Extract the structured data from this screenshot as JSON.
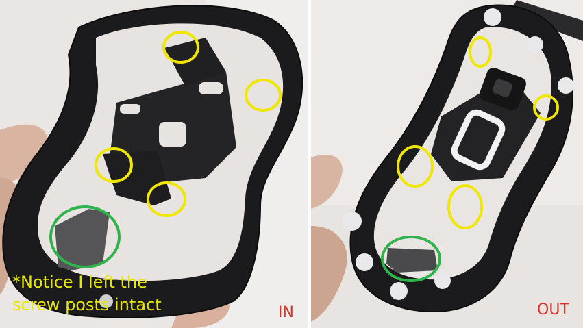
{
  "panels": {
    "in": {
      "label": "IN"
    },
    "out": {
      "label": "OUT"
    }
  },
  "caption": {
    "line1": "*Notice I left the",
    "line2": "screw posts intact"
  },
  "colors": {
    "highlight_screw_posts": "#f0e600",
    "highlight_weight_pad": "#2fb34a",
    "caption_text": "#e8e800",
    "label_text": "#d9342b",
    "mouse_shell": "#1a1a1c",
    "mouse_feet": "#e9e9ec"
  },
  "annotations": {
    "in_screw_post_circles": 4,
    "in_pad_circles": 1,
    "out_screw_post_circles": 4,
    "out_pad_circles": 1
  }
}
